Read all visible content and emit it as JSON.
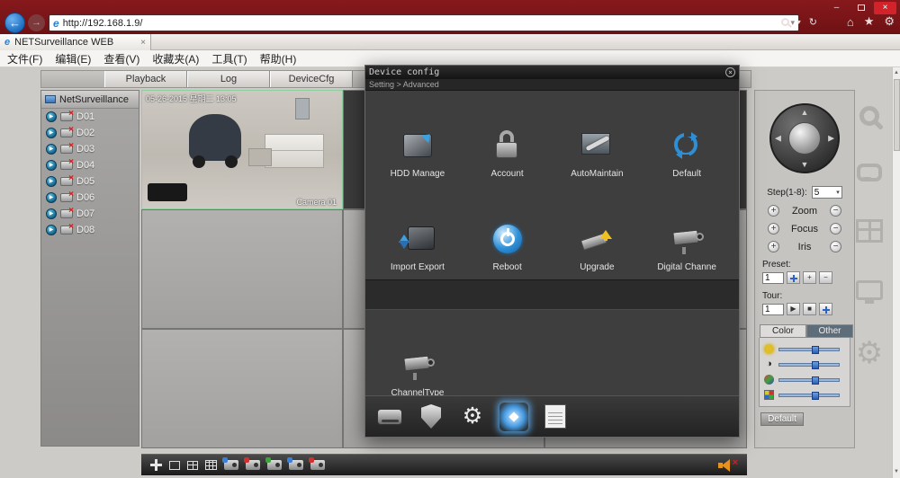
{
  "browser": {
    "url": "http://192.168.1.9/",
    "tab_title": "NETSurveillance WEB",
    "menu": [
      "文件(F)",
      "编辑(E)",
      "查看(V)",
      "收藏夹(A)",
      "工具(T)",
      "帮助(H)"
    ]
  },
  "icons": {
    "close": "×",
    "minimize": "–",
    "dropdown": "▾",
    "refresh": "↻",
    "home": "⌂",
    "favorites": "★",
    "tools": "⚙",
    "back": "←",
    "forward": "→",
    "scroll_up": "▲",
    "scroll_down": "▼",
    "arrow_up": "▲",
    "arrow_down": "▼",
    "arrow_left": "◀",
    "arrow_right": "▶",
    "plus": "+",
    "minus": "−",
    "play": "▶",
    "stop": "■",
    "contrast": "◑",
    "favicon": "e",
    "mute_x": "×",
    "gear": "⚙"
  },
  "page_tabs": [
    {
      "label": "Playback"
    },
    {
      "label": "Log"
    },
    {
      "label": "DeviceCfg"
    }
  ],
  "tree": {
    "root": "NetSurveillance",
    "channels": [
      "D01",
      "D02",
      "D03",
      "D04",
      "D05",
      "D06",
      "D07",
      "D08"
    ]
  },
  "video": {
    "timestamp": "05-26-2015 星期二 13:05",
    "camera_label": "Camera 01"
  },
  "ptz": {
    "step_label": "Step(1-8):",
    "step_value": "5",
    "rows": [
      {
        "label": "Zoom"
      },
      {
        "label": "Focus"
      },
      {
        "label": "Iris"
      }
    ],
    "preset_label": "Preset:",
    "preset_value": "1",
    "tour_label": "Tour:",
    "tour_value": "1"
  },
  "color_panel": {
    "tabs": [
      {
        "label": "Color"
      },
      {
        "label": "Other"
      }
    ],
    "sliders": [
      {
        "name": "brightness",
        "value": 55
      },
      {
        "name": "contrast",
        "value": 55
      },
      {
        "name": "saturation",
        "value": 55
      },
      {
        "name": "hue",
        "value": 55
      }
    ],
    "default_button": "Default"
  },
  "dialog": {
    "title": "Device config",
    "breadcrumb": "Setting > Advanced",
    "items": [
      {
        "label": "HDD Manage"
      },
      {
        "label": "Account"
      },
      {
        "label": "AutoMaintain"
      },
      {
        "label": "Default"
      },
      {
        "label": "Import Export"
      },
      {
        "label": "Reboot"
      },
      {
        "label": "Upgrade"
      },
      {
        "label": "Digital Channe"
      }
    ],
    "items2": [
      {
        "label": "ChannelType"
      }
    ]
  }
}
